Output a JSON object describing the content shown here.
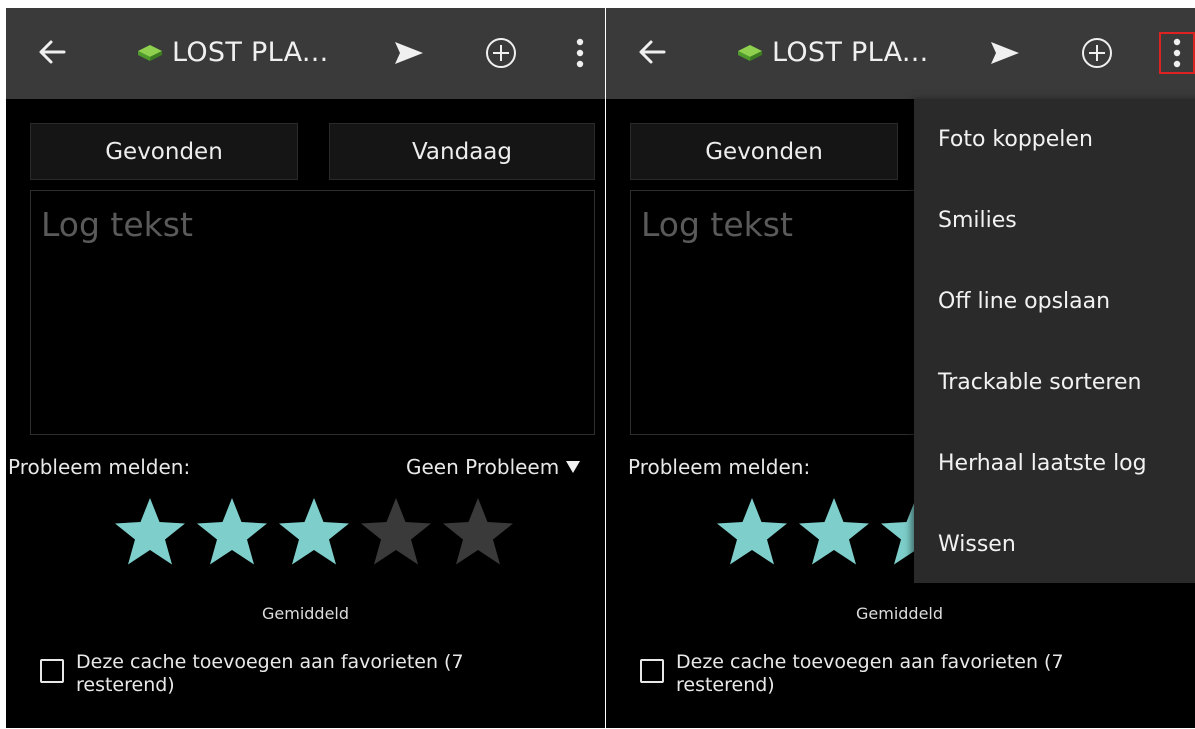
{
  "panels": [
    {
      "toolbar": {
        "title": "LOST PLA..."
      },
      "type_button": "Gevonden",
      "date_button": "Vandaag",
      "log_placeholder": "Log tekst",
      "problem_label": "Probleem melden:",
      "problem_value": "Geen Probleem",
      "rating": {
        "value": 3,
        "max": 5,
        "label": "Gemiddeld"
      },
      "favorite_text": "Deze cache toevoegen aan favorieten (7 resterend)",
      "favorite_checked": false
    },
    {
      "toolbar": {
        "title": "LOST PLA..."
      },
      "type_button": "Gevonden",
      "log_placeholder": "Log tekst",
      "problem_label": "Probleem melden:",
      "rating": {
        "value": 3,
        "max": 5,
        "label": "Gemiddeld"
      },
      "favorite_text": "Deze cache toevoegen aan favorieten (7 resterend)",
      "favorite_checked": false,
      "menu": {
        "items": [
          "Foto koppelen",
          "Smilies",
          "Off line opslaan",
          "Trackable sorteren",
          "Herhaal laatste log",
          "Wissen"
        ]
      }
    }
  ],
  "colors": {
    "toolbar": "#3a3a3a",
    "star_filled": "#7ecfcb",
    "star_empty": "#3a3a3a",
    "highlight": "#dd2222",
    "cache_icon": "#6fbf3a"
  },
  "icons": [
    "back-arrow-icon",
    "cache-icon",
    "send-icon",
    "add-circle-icon",
    "overflow-menu-icon",
    "dropdown-triangle-icon",
    "star-icon",
    "checkbox-icon"
  ]
}
